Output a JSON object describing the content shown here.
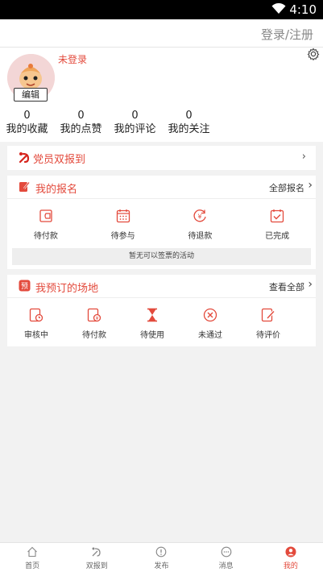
{
  "status_bar": {
    "time": "4:10"
  },
  "header": {
    "login_label": "登录/注册"
  },
  "profile": {
    "username": "未登录",
    "edit_label": "编辑",
    "stats": [
      {
        "count": "0",
        "label": "我的收藏"
      },
      {
        "count": "0",
        "label": "我的点赞"
      },
      {
        "count": "0",
        "label": "我的评论"
      },
      {
        "count": "0",
        "label": "我的关注"
      }
    ]
  },
  "party_report": {
    "title": "党员双报到",
    "arrow": "›"
  },
  "my_signup": {
    "title": "我的报名",
    "more_label": "全部报名",
    "items": [
      {
        "label": "待付款",
        "icon": "wallet-icon"
      },
      {
        "label": "待参与",
        "icon": "calendar-icon"
      },
      {
        "label": "待退款",
        "icon": "refund-icon"
      },
      {
        "label": "已完成",
        "icon": "check-calendar-icon"
      }
    ],
    "empty_text": "暂无可以签票的活动"
  },
  "my_venue": {
    "title": "我预订的场地",
    "more_label": "查看全部",
    "items": [
      {
        "label": "审核中",
        "icon": "reviewing-icon"
      },
      {
        "label": "待付款",
        "icon": "pay-icon"
      },
      {
        "label": "待使用",
        "icon": "hourglass-icon"
      },
      {
        "label": "未通过",
        "icon": "rejected-icon"
      },
      {
        "label": "待评价",
        "icon": "review-edit-icon"
      }
    ]
  },
  "tabbar": [
    {
      "label": "首页",
      "icon": "home-icon"
    },
    {
      "label": "双报到",
      "icon": "party-icon"
    },
    {
      "label": "发布",
      "icon": "publish-icon"
    },
    {
      "label": "消息",
      "icon": "message-icon"
    },
    {
      "label": "我的",
      "icon": "profile-icon",
      "active": true
    }
  ],
  "colors": {
    "accent": "#e34a3c",
    "background": "#f2f2f2"
  }
}
